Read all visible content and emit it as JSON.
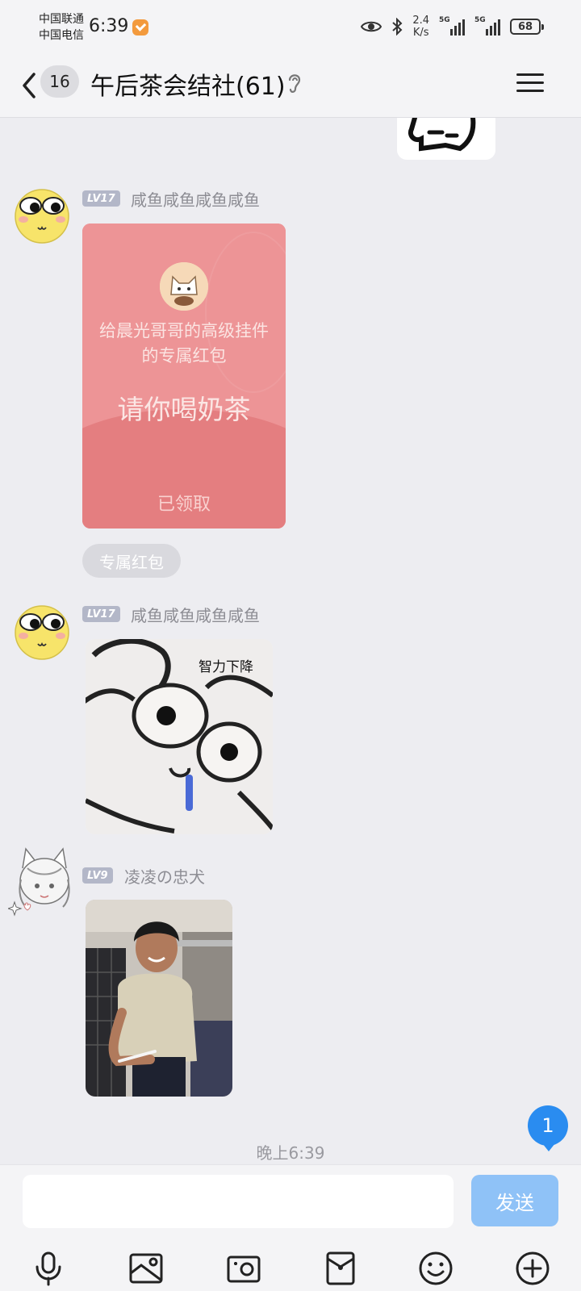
{
  "status_bar": {
    "carrier_1": "中国联通",
    "carrier_2": "中国电信",
    "time": "6:39",
    "speed_value": "2.4",
    "speed_unit": "K/s",
    "net_1": "5G",
    "net_2": "5G",
    "battery": "68"
  },
  "header": {
    "unread_count": "16",
    "title": "午后茶会结社(61)"
  },
  "messages": [
    {
      "level": "LV17",
      "nickname": "咸鱼咸鱼咸鱼咸鱼",
      "type": "red_packet",
      "red_packet": {
        "description": "给晨光哥哥的高级挂件的专属红包",
        "main_text": "请你喝奶茶",
        "status": "已领取",
        "tag": "专属红包"
      }
    },
    {
      "level": "LV17",
      "nickname": "咸鱼咸鱼咸鱼咸鱼",
      "type": "sticker",
      "caption": "智力下降"
    },
    {
      "level": "LV9",
      "nickname": "凌凌の忠犬",
      "type": "photo"
    }
  ],
  "new_message_count": "1",
  "time_divider": "晚上6:39",
  "composer": {
    "input_value": "",
    "send_label": "发送"
  },
  "toolbar_icons": [
    "mic-icon",
    "image-icon",
    "camera-icon",
    "red-packet-icon",
    "emoji-icon",
    "plus-icon"
  ],
  "colors": {
    "red_packet": "#ed9496",
    "send_button": "#8fc2f7",
    "new_badge": "#2a8cf0",
    "level_badge": "#b3b7c8"
  }
}
